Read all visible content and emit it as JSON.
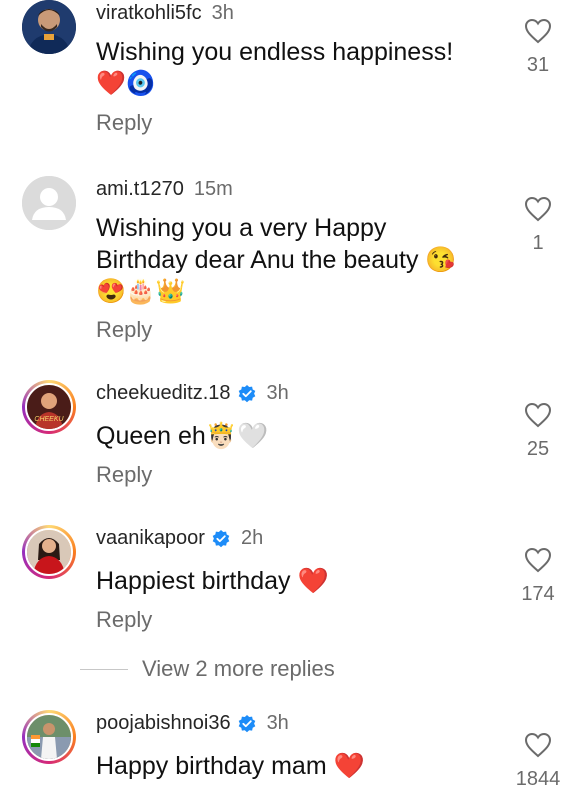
{
  "comments": [
    {
      "username": "viratkohli5fc",
      "time": "3h",
      "text": "Wishing you endless happiness!",
      "text2": "❤️🧿",
      "reply": "Reply",
      "likes": "31",
      "verified": false,
      "avatar_icon": "profile-photo"
    },
    {
      "username": "ami.t1270",
      "time": "15m",
      "text": "Wishing you a very Happy",
      "text2": "Birthday dear Anu the beauty 😘",
      "text3": "😍🎂👑",
      "reply": "Reply",
      "likes": "1",
      "verified": false,
      "avatar_icon": "default-user-icon"
    },
    {
      "username": "cheekueditz.18",
      "time": "3h",
      "text": "Queen eh🤴🏻🤍",
      "reply": "Reply",
      "likes": "25",
      "verified": true,
      "avatar_icon": "profile-photo",
      "avatar_label": "CHEEKU"
    },
    {
      "username": "vaanikapoor",
      "time": "2h",
      "text": "Happiest birthday ❤️",
      "reply": "Reply",
      "likes": "174",
      "verified": true,
      "avatar_icon": "profile-photo"
    },
    {
      "username": "poojabishnoi36",
      "time": "3h",
      "text": "Happy birthday mam ❤️",
      "reply": "Reply",
      "likes": "1844",
      "verified": true,
      "avatar_icon": "profile-photo"
    }
  ],
  "view_more": "View 2 more replies",
  "colors": {
    "verified": "#1d8cf8",
    "text_secondary": "#6b6b6b",
    "heart_outline": "#6b6b6b"
  }
}
